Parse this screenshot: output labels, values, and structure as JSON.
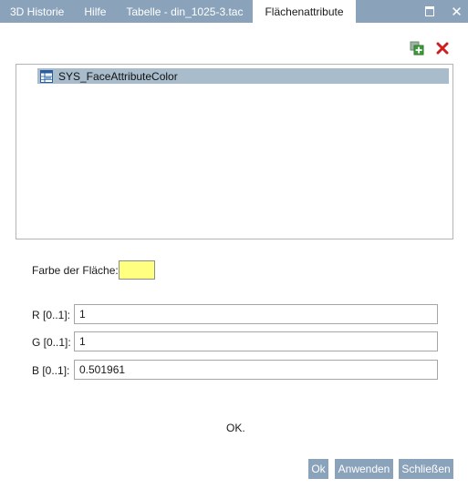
{
  "tabs": [
    {
      "label": "3D Historie",
      "active": false
    },
    {
      "label": "Hilfe",
      "active": false
    },
    {
      "label": "Tabelle - din_1025-3.tac",
      "active": false
    },
    {
      "label": "Flächenattribute",
      "active": true
    }
  ],
  "window_controls": {
    "restore_icon": "restore-icon",
    "close_glyph": "✕"
  },
  "toolbar": {
    "add_icon": "add-attribute-icon",
    "delete_icon": "delete-attribute-icon"
  },
  "attribute_list": {
    "items": [
      {
        "label": "SYS_FaceAttributeColor",
        "icon": "attribute-table-icon",
        "selected": true
      }
    ]
  },
  "color": {
    "label": "Farbe der Fläche:",
    "swatch_hex": "#ffff80"
  },
  "fields": {
    "r": {
      "label": "R [0..1]:",
      "value": "1"
    },
    "g": {
      "label": "G [0..1]:",
      "value": "1"
    },
    "b": {
      "label": "B [0..1]:",
      "value": "0.501961"
    }
  },
  "status": "OK.",
  "buttons": {
    "ok": "Ok",
    "apply": "Anwenden",
    "close": "Schließen"
  },
  "theme": {
    "tab_bar": "#8aa3bb",
    "button": "#8aa3bb",
    "selection": "#a8bccc"
  }
}
